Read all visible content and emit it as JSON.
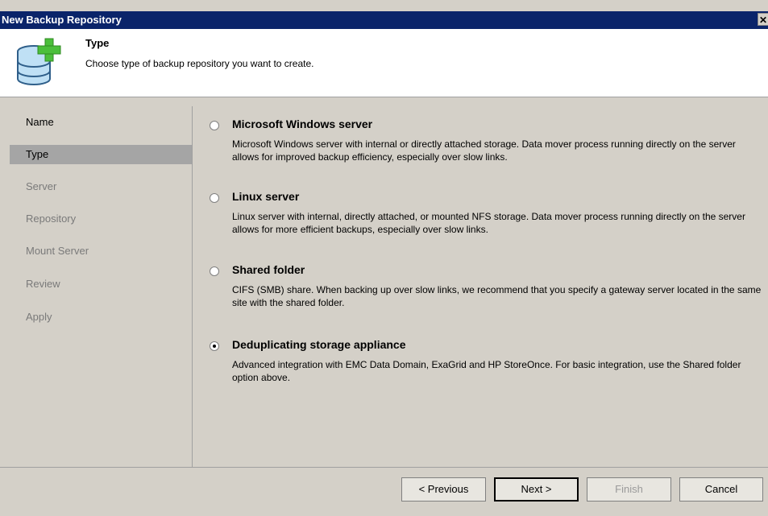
{
  "window": {
    "title": "New Backup Repository",
    "close_glyph": "✕"
  },
  "header": {
    "icon": "database-add-icon",
    "title": "Type",
    "subtitle": "Choose type of backup repository you want to create."
  },
  "sidebar": {
    "items": [
      {
        "label": "Name",
        "state": "done"
      },
      {
        "label": "Type",
        "state": "active"
      },
      {
        "label": "Server",
        "state": "todo"
      },
      {
        "label": "Repository",
        "state": "todo"
      },
      {
        "label": "Mount Server",
        "state": "todo"
      },
      {
        "label": "Review",
        "state": "todo"
      },
      {
        "label": "Apply",
        "state": "todo"
      }
    ]
  },
  "options": [
    {
      "title": "Microsoft Windows server",
      "description": "Microsoft Windows server with internal or directly attached storage. Data mover process running directly on the server allows for improved backup efficiency, especially over slow links.",
      "selected": false
    },
    {
      "title": "Linux server",
      "description": "Linux server with internal, directly attached, or mounted NFS storage. Data mover process running directly on the server allows for more efficient backups, especially over slow links.",
      "selected": false
    },
    {
      "title": "Shared folder",
      "description": "CIFS (SMB) share. When backing up over slow links, we recommend that you specify a gateway server located in the same site with the shared folder.",
      "selected": false
    },
    {
      "title": "Deduplicating storage appliance",
      "description": "Advanced integration with EMC Data Domain, ExaGrid and HP StoreOnce. For basic integration, use the Shared folder option above.",
      "selected": true
    }
  ],
  "buttons": {
    "previous": "< Previous",
    "next": "Next >",
    "finish": "Finish",
    "cancel": "Cancel"
  }
}
